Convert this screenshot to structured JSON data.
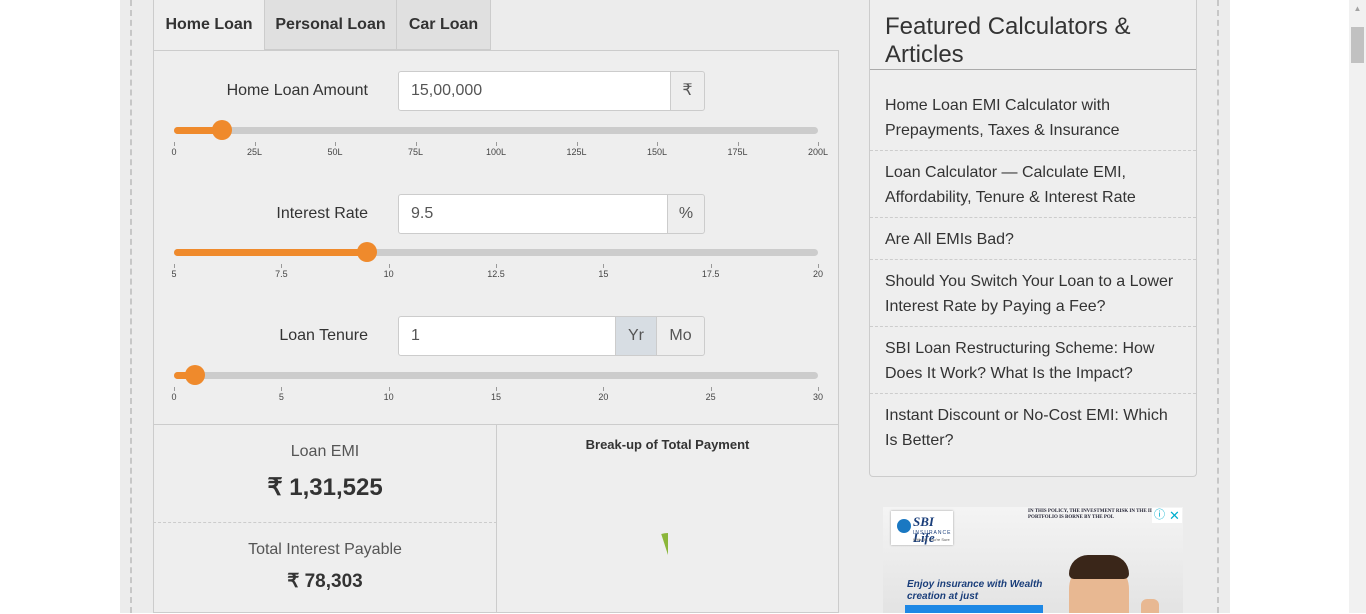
{
  "tabs": [
    {
      "label": "Home Loan",
      "active": true
    },
    {
      "label": "Personal Loan",
      "active": false
    },
    {
      "label": "Car Loan",
      "active": false
    }
  ],
  "calculator": {
    "amount": {
      "label": "Home Loan Amount",
      "value": "15,00,000",
      "unit": "₹",
      "slider_fraction": 0.075,
      "ticks": [
        "0",
        "25L",
        "50L",
        "75L",
        "100L",
        "125L",
        "150L",
        "175L",
        "200L"
      ]
    },
    "rate": {
      "label": "Interest Rate",
      "value": "9.5",
      "unit": "%",
      "slider_fraction": 0.3,
      "ticks": [
        "5",
        "7.5",
        "10",
        "12.5",
        "15",
        "17.5",
        "20"
      ]
    },
    "tenure": {
      "label": "Loan Tenure",
      "value": "1",
      "unit_year": "Yr",
      "unit_month": "Mo",
      "selected_unit": "Yr",
      "slider_fraction": 0.0333,
      "ticks": [
        "0",
        "5",
        "10",
        "15",
        "20",
        "25",
        "30"
      ]
    }
  },
  "results": {
    "emi_label": "Loan EMI",
    "emi_value": "₹ 1,31,525",
    "interest_label": "Total Interest Payable",
    "interest_value": "₹ 78,303",
    "chart_title": "Break-up of Total Payment"
  },
  "chart_data": {
    "type": "pie",
    "title": "Break-up of Total Payment",
    "slices": [
      {
        "value": 1500000,
        "color": "#eeeeee"
      },
      {
        "value": 78303,
        "color": "#8bb63a"
      }
    ]
  },
  "sidebar": {
    "title": "Featured Calculators & Articles",
    "items": [
      "Home Loan EMI Calculator with Prepayments, Taxes & Insurance",
      "Loan Calculator — Calculate EMI, Affordability, Tenure & Interest Rate",
      "Are All EMIs Bad?",
      "Should You Switch Your Loan to a Lower Interest Rate by Paying a Fee?",
      "SBI Loan Restructuring Scheme: How Does It Work? What Is the Impact?",
      "Instant Discount or No-Cost EMI: Which Is Better?"
    ]
  },
  "ad": {
    "brand": "SBI Life",
    "brand_sub": "INSURANCE",
    "brand_tagline": "With Us, You're Sure",
    "disclaimer": "IN THIS POLICY, THE INVESTMENT RISK IN THE II PORTFOLIO IS BORNE BY THE POL",
    "tagline": "Enjoy insurance with Wealth creation at just",
    "info_icon": "info-icon",
    "close_icon": "close-icon"
  }
}
